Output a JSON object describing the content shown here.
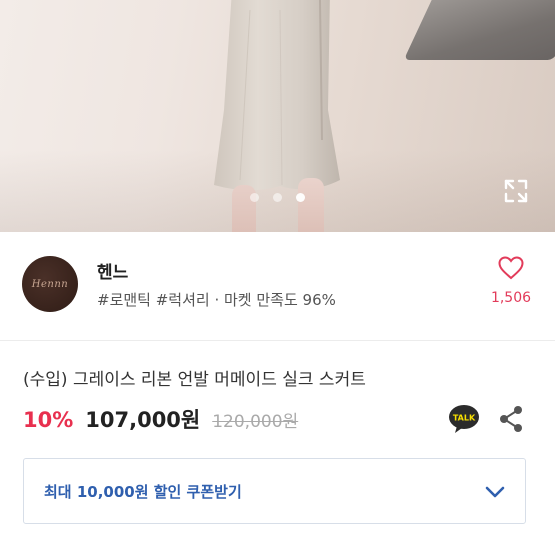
{
  "gallery": {
    "page_count": 3,
    "active_index": 2
  },
  "seller": {
    "avatar_text": "Hennn",
    "name": "헨느",
    "tags": "#로맨틱 #럭셔리 · 마켓 만족도 96%",
    "like_count": "1,506"
  },
  "product": {
    "title": "(수입) 그레이스 리본 언발 머메이드 실크 스커트",
    "discount": "10%",
    "price": "107,000원",
    "original_price": "120,000원"
  },
  "coupon": {
    "label": "최대 10,000원 할인 쿠폰받기"
  },
  "icons": {
    "expand": "expand-icon",
    "heart": "heart-icon",
    "talk": "kakao-talk-icon",
    "share": "share-icon",
    "chevron": "chevron-down-icon"
  },
  "colors": {
    "accent_red": "#e8304f",
    "like_pink": "#e23b5a",
    "coupon_blue": "#2f5fae",
    "talk_yellow": "#f9e000"
  }
}
